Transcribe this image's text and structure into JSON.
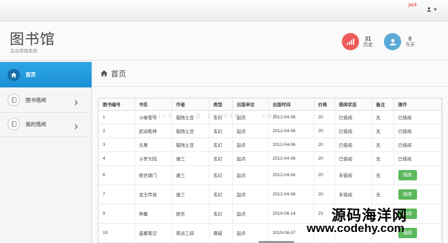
{
  "topbar": {
    "username": "jack"
  },
  "header": {
    "title": "图书馆",
    "subtitle": "后台管理系统",
    "stats": [
      {
        "value": "31",
        "label": "历史",
        "color": "#ee5b5b"
      },
      {
        "value": "0",
        "label": "今天",
        "color": "#5ba9d6"
      }
    ]
  },
  "sidebar": {
    "items": [
      {
        "label": "首页",
        "icon": "home-icon"
      },
      {
        "label": "图书借阅",
        "icon": "book-icon"
      },
      {
        "label": "我的借阅",
        "icon": "book-icon"
      }
    ]
  },
  "breadcrumb": {
    "label": "首页"
  },
  "table": {
    "headers": [
      "图书编号",
      "书名",
      "作者",
      "类型",
      "出版单位",
      "出版时间",
      "价格",
      "借阅状态",
      "备注",
      "操作"
    ],
    "rows": [
      {
        "id": "1",
        "name": "斗破苍穹",
        "author": "脑残土豆",
        "type": "玄幻",
        "publisher": "起点",
        "date": "2012-04-06",
        "price": "20",
        "status": "已借阅",
        "note": "无",
        "action": "已借阅",
        "button": false
      },
      {
        "id": "2",
        "name": "武动乾坤",
        "author": "脑残土豆",
        "type": "玄幻",
        "publisher": "起点",
        "date": "2012-04-06",
        "price": "20",
        "status": "已借阅",
        "note": "无",
        "action": "已借阅",
        "button": false
      },
      {
        "id": "3",
        "name": "元尊",
        "author": "脑残土豆",
        "type": "玄幻",
        "publisher": "起点",
        "date": "2012-04-06",
        "price": "20",
        "status": "已借阅",
        "note": "无",
        "action": "已借阅",
        "button": false
      },
      {
        "id": "4",
        "name": "斗罗大陆",
        "author": "唐三",
        "type": "玄幻",
        "publisher": "起点",
        "date": "2012-04-06",
        "price": "20",
        "status": "已借阅",
        "note": "无",
        "action": "已借阅",
        "button": false
      },
      {
        "id": "6",
        "name": "绝世唐门",
        "author": "唐三",
        "type": "玄幻",
        "publisher": "起点",
        "date": "2012-04-06",
        "price": "20",
        "status": "未借阅",
        "note": "无",
        "action": "借阅",
        "button": true
      },
      {
        "id": "7",
        "name": "龙王传说",
        "author": "唐三",
        "type": "玄幻",
        "publisher": "起点",
        "date": "2012-04-06",
        "price": "20",
        "status": "未借阅",
        "note": "无",
        "action": "借阅",
        "button": true
      },
      {
        "id": "9",
        "name": "神墓",
        "author": "辰东",
        "type": "玄幻",
        "publisher": "起点",
        "date": "2019-08-14",
        "price": "23",
        "status": "",
        "note": "",
        "action": "借阅",
        "button": true
      },
      {
        "id": "10",
        "name": "盗墓笔记",
        "author": "南派三叔",
        "type": "悬疑",
        "publisher": "起点",
        "date": "2019-08-07",
        "price": "",
        "status": "",
        "note": "",
        "action": "借阅",
        "button": true
      }
    ]
  },
  "watermarks": {
    "faint": "nick  su @ zuidima . com",
    "site_cn": "源码海洋网",
    "site_en": "www.codehy.com"
  }
}
